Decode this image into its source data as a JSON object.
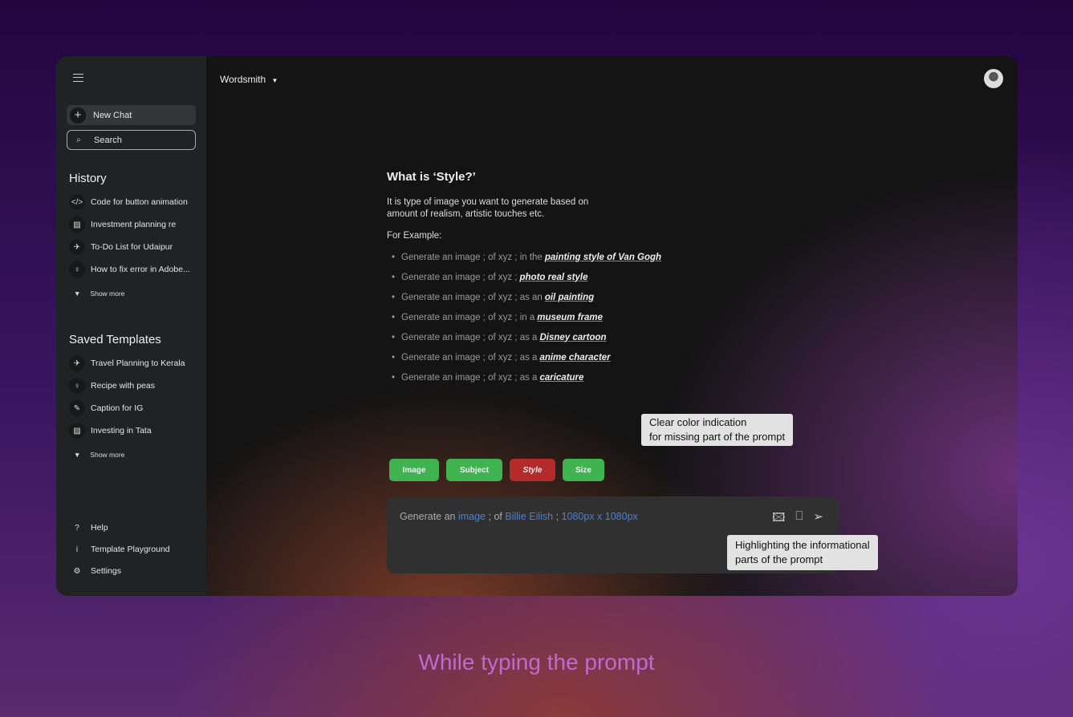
{
  "sidebar": {
    "new_chat": "New Chat",
    "search_placeholder": "Search",
    "history_title": "History",
    "history": [
      {
        "icon": "code-icon",
        "glyph": "</>",
        "label": "Code for button animation"
      },
      {
        "icon": "chart-icon",
        "glyph": "▨",
        "label": "Investment planning re"
      },
      {
        "icon": "airplane-icon",
        "glyph": "✈",
        "label": "To-Do List for Udaipur"
      },
      {
        "icon": "lightbulb-icon",
        "glyph": "♀",
        "label": "How to fix error in Adobe..."
      }
    ],
    "show_more": "Show more",
    "templates_title": "Saved Templates",
    "templates": [
      {
        "icon": "airplane-icon",
        "glyph": "✈",
        "label": "Travel Planning to Kerala"
      },
      {
        "icon": "lightbulb-icon",
        "glyph": "♀",
        "label": "Recipe with peas"
      },
      {
        "icon": "pencil-icon",
        "glyph": "✎",
        "label": "Caption for IG"
      },
      {
        "icon": "chart-icon",
        "glyph": "▨",
        "label": "Investing in Tata"
      }
    ],
    "footer": [
      {
        "icon": "help-icon",
        "glyph": "?",
        "label": "Help"
      },
      {
        "icon": "info-icon",
        "glyph": "i",
        "label": "Template Playground"
      },
      {
        "icon": "gear-icon",
        "glyph": "⚙",
        "label": "Settings"
      }
    ]
  },
  "header": {
    "title": "Wordsmith"
  },
  "content": {
    "heading": "What is ‘Style?’",
    "description": "It is type of image you want to generate based on amount of realism, artistic touches etc.",
    "example_label": "For Example:",
    "examples": [
      {
        "prefix": "Generate an image ; of xyz ; in the",
        "style": "painting style of Van Gogh"
      },
      {
        "prefix": "Generate an image ; of xyz ;",
        "style": "photo real style"
      },
      {
        "prefix": "Generate an image ; of xyz ; as an",
        "style": "oil painting"
      },
      {
        "prefix": "Generate an image ; of xyz ; in a",
        "style": "museum frame"
      },
      {
        "prefix": "Generate an image ; of xyz ; as a",
        "style": "Disney cartoon"
      },
      {
        "prefix": "Generate an image ; of xyz ; as a",
        "style": "anime character"
      },
      {
        "prefix": "Generate an image ; of xyz ; as a",
        "style": "caricature"
      }
    ]
  },
  "annotations": {
    "color_tip": "Clear color indication\nfor missing part of the prompt",
    "highlight_tip": "Highlighting the informational\nparts of the prompt"
  },
  "chips": [
    {
      "label": "Image",
      "status": "complete",
      "color": "#3fb34f"
    },
    {
      "label": "Subject",
      "status": "complete",
      "color": "#3fb34f"
    },
    {
      "label": "Style",
      "status": "missing",
      "color": "#b52a2a"
    },
    {
      "label": "Size",
      "status": "complete",
      "color": "#3fb34f"
    }
  ],
  "prompt": {
    "p1": "Generate an",
    "image": "image",
    "p2": "; of",
    "subject": "Billie Eilish",
    "p3": ";",
    "size": "1080px x 1080px",
    "highlight_color": "#4a7fd8"
  },
  "caption": "While typing the prompt"
}
